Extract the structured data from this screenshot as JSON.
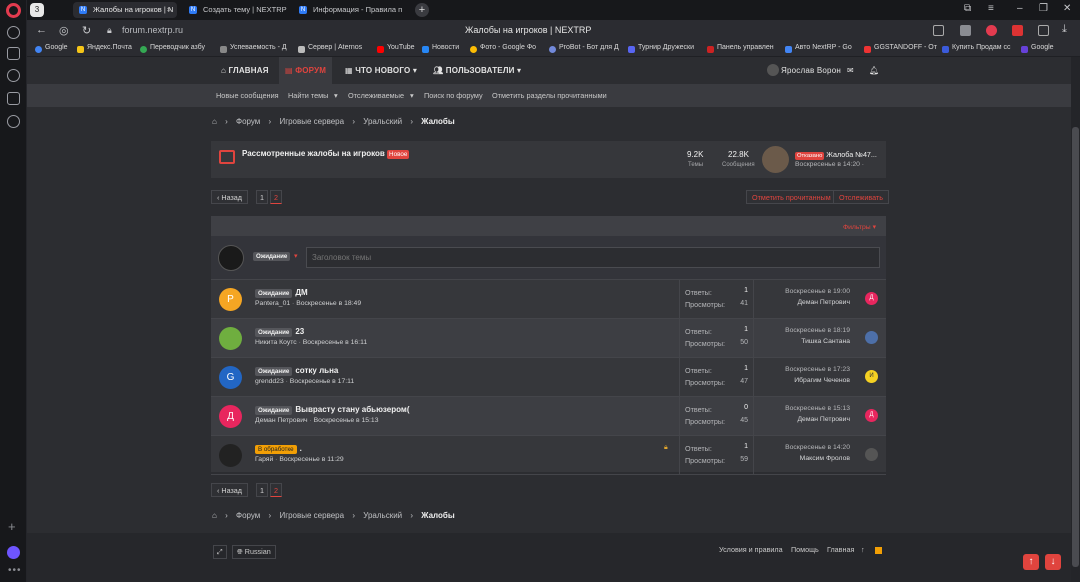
{
  "browser": {
    "tabs": [
      {
        "label": "Жалобы на игроков | N",
        "active": true
      },
      {
        "label": "Создать тему | NEXTRP",
        "active": false
      },
      {
        "label": "Информация - Правила п",
        "active": false
      }
    ],
    "url": "forum.nextrp.ru",
    "page_title": "Жалобы на игроков | NEXTRP",
    "bookmarks": [
      "Google",
      "Яндекс.Почта",
      "Переводчик азбу",
      "Успеваемость - Д",
      "Сервер | Aternos",
      "YouTube",
      "Новости",
      "Фото - Google Фо",
      "ProBot - Бот для Д",
      "Турнир Дружески",
      "Панель управлен",
      "Авто NextRP - Go",
      "GGSTANDOFF - От",
      "Купить Продам сс",
      "Google"
    ]
  },
  "nav": {
    "home": "ГЛАВНАЯ",
    "forum": "ФОРУМ",
    "whatsnew": "ЧТО НОВОГО",
    "users": "ПОЛЬЗОВАТЕЛИ",
    "username": "Ярослав Ворон"
  },
  "subnav": [
    "Новые сообщения",
    "Найти темы",
    "Отслеживаемые",
    "Поиск по форуму",
    "Отметить разделы прочитанными"
  ],
  "breadcrumb": [
    "Форум",
    "Игровые сервера",
    "Уральский",
    "Жалобы"
  ],
  "subforum": {
    "title": "Рассмотренные жалобы на игроков",
    "badge": "Новое",
    "threads_value": "9.2K",
    "threads_label": "Темы",
    "messages_value": "22.8K",
    "messages_label": "Сообщения",
    "last_prefix": "Отказано",
    "last_title": "Жалоба №47...",
    "last_time": "Воскресенье в 14:20 ·"
  },
  "pagination": {
    "back": "Назад",
    "pages": [
      "1",
      "2"
    ],
    "current": "2"
  },
  "actions": {
    "mark_read": "Отметить прочитанным",
    "watch": "Отслеживать"
  },
  "filters": "Фильтры",
  "new_thread": {
    "prefix": "Ожидание",
    "placeholder": "Заголовок темы"
  },
  "stats_labels": {
    "replies": "Ответы:",
    "views": "Просмотры:"
  },
  "threads": [
    {
      "avatar": "P",
      "color": "#f5a623",
      "prefix": "Ожидание",
      "title": "ДМ",
      "author": "Pantera_01",
      "time": "Воскресенье в 18:49",
      "replies": "1",
      "views": "41",
      "last_time": "Воскресенье в 19:00",
      "last_user": "Деман Петрович",
      "last_av": "Д",
      "last_color": "#e8265e"
    },
    {
      "avatar": "",
      "color": "#6fae3f",
      "prefix": "Ожидание",
      "title": "23",
      "author": "Никита Коутс",
      "time": "Воскресенье в 16:11",
      "replies": "1",
      "views": "50",
      "last_time": "Воскресенье в 18:19",
      "last_user": "Тишка Сантана",
      "last_av": "",
      "last_color": "#4d6fa8"
    },
    {
      "avatar": "G",
      "color": "#2266c4",
      "prefix": "Ожидание",
      "title": "сотку льна",
      "author": "grendd23",
      "time": "Воскресенье в 17:11",
      "replies": "1",
      "views": "47",
      "last_time": "Воскресенье в 17:23",
      "last_user": "Ибрагим Чеченов",
      "last_av": "И",
      "last_color": "#f5d123"
    },
    {
      "avatar": "Д",
      "color": "#e8265e",
      "prefix": "Ожидание",
      "title": "Выврасту стану абьюзером(",
      "author": "Деман Петрович",
      "time": "Воскресенье в 15:13",
      "replies": "0",
      "views": "45",
      "last_time": "Воскресенье в 15:13",
      "last_user": "Деман Петрович",
      "last_av": "Д",
      "last_color": "#e8265e"
    },
    {
      "avatar": "",
      "color": "#222",
      "prefix": "В обработке",
      "title": ".",
      "author": "Гаряй",
      "time": "Воскресенье в 11:29",
      "replies": "1",
      "views": "59",
      "last_time": "Воскресенье в 14:20",
      "last_user": "Максим Фролов",
      "last_av": "",
      "last_color": "#555"
    }
  ],
  "footer": {
    "language": "Russian",
    "terms": "Условия и правила",
    "help": "Помощь",
    "home": "Главная"
  }
}
